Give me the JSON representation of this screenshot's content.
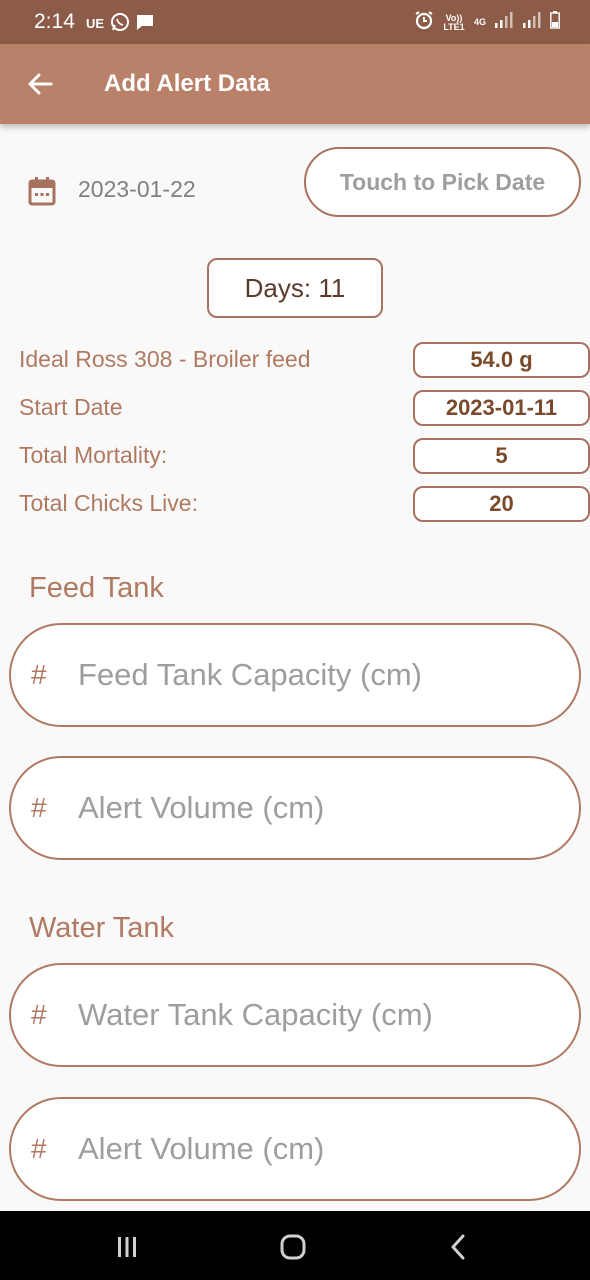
{
  "status_bar": {
    "time": "2:14",
    "carrier_badge": "UE",
    "volte_label": "Vo)) LTE1",
    "network_label": "4G",
    "icons": [
      "whatsapp-icon",
      "chat-icon",
      "alarm-icon",
      "signal-icon",
      "battery-icon"
    ]
  },
  "app_bar": {
    "title": "Add Alert Data",
    "back_icon": "arrow-left-icon"
  },
  "date_section": {
    "icon": "calendar-icon",
    "selected_date": "2023-01-22",
    "pick_date_label": "Touch to Pick Date"
  },
  "days_label": "Days: 11",
  "info": [
    {
      "label": "Ideal Ross 308 - Broiler feed",
      "value": "54.0 g"
    },
    {
      "label": "Start Date",
      "value": "2023-01-11"
    },
    {
      "label": "Total Mortality:",
      "value": "5"
    },
    {
      "label": "Total Chicks Live:",
      "value": "20"
    }
  ],
  "feed_tank": {
    "title": "Feed Tank",
    "capacity_placeholder": "Feed Tank Capacity (cm)",
    "alert_placeholder": "Alert Volume (cm)",
    "prefix": "#"
  },
  "water_tank": {
    "title": "Water Tank",
    "capacity_placeholder": "Water Tank Capacity (cm)",
    "alert_placeholder": "Alert Volume (cm)",
    "prefix": "#"
  },
  "nav_bar": {
    "icons": [
      "recent-apps-icon",
      "home-icon",
      "back-icon"
    ]
  },
  "colors": {
    "status_bar": "#8d5c48",
    "app_bar": "#b98169",
    "accent": "#b07a62",
    "background": "#f9f9f9"
  }
}
